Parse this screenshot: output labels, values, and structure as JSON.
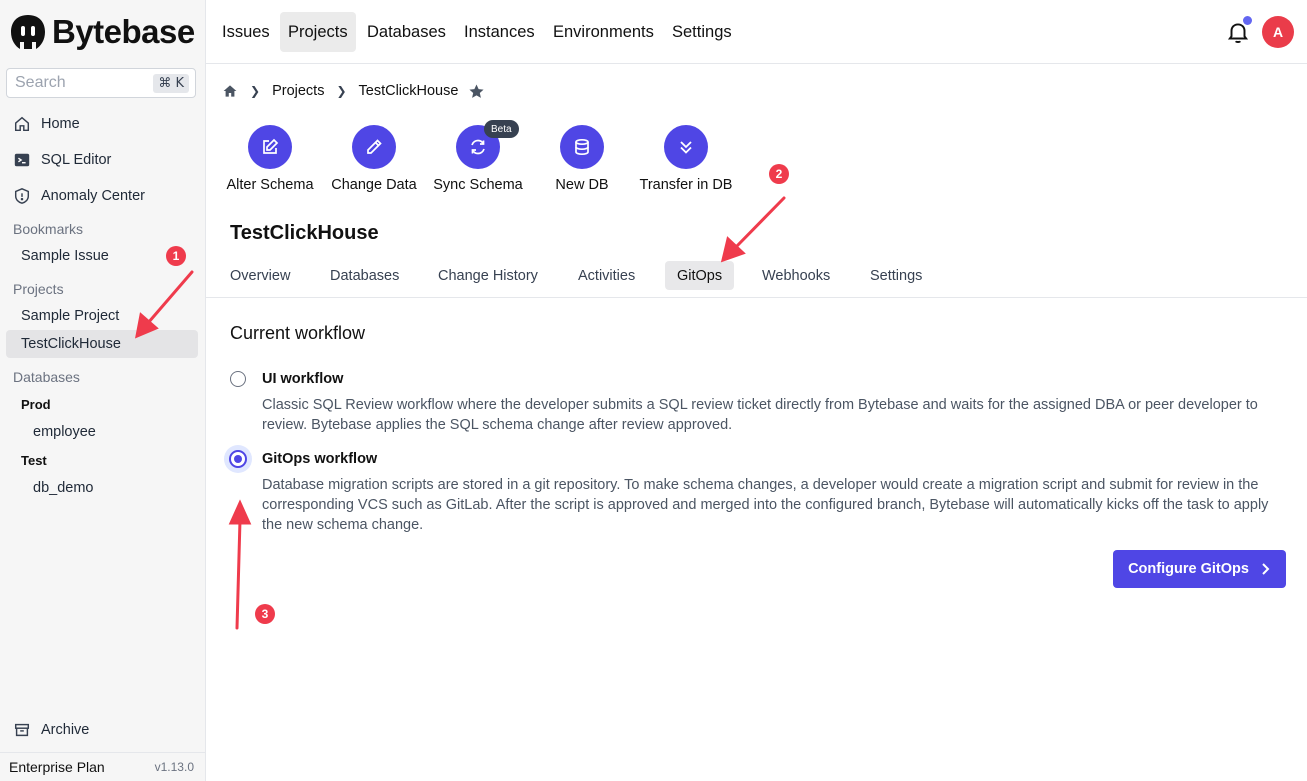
{
  "brand": {
    "name": "Bytebase"
  },
  "search": {
    "placeholder": "Search",
    "shortcut": "⌘ K"
  },
  "sidebar": {
    "nav": [
      {
        "label": "Home",
        "icon": "home-icon"
      },
      {
        "label": "SQL Editor",
        "icon": "terminal-icon"
      },
      {
        "label": "Anomaly Center",
        "icon": "shield-icon"
      }
    ],
    "bookmarks_label": "Bookmarks",
    "bookmarks": [
      {
        "label": "Sample Issue"
      }
    ],
    "projects_label": "Projects",
    "projects": [
      {
        "label": "Sample Project"
      },
      {
        "label": "TestClickHouse",
        "active": true
      }
    ],
    "databases_label": "Databases",
    "environments": [
      {
        "name": "Prod",
        "databases": [
          "employee"
        ]
      },
      {
        "name": "Test",
        "databases": [
          "db_demo"
        ]
      }
    ],
    "archive_label": "Archive",
    "plan": "Enterprise Plan",
    "version": "v1.13.0"
  },
  "topnav": {
    "items": [
      "Issues",
      "Projects",
      "Databases",
      "Instances",
      "Environments",
      "Settings"
    ],
    "active": "Projects",
    "avatar_initial": "A"
  },
  "breadcrumb": {
    "section": "Projects",
    "current": "TestClickHouse"
  },
  "quick_actions": [
    {
      "label": "Alter Schema",
      "icon": "edit-icon"
    },
    {
      "label": "Change Data",
      "icon": "pencil-icon"
    },
    {
      "label": "Sync Schema",
      "icon": "refresh-icon",
      "badge": "Beta"
    },
    {
      "label": "New DB",
      "icon": "database-icon"
    },
    {
      "label": "Transfer in DB",
      "icon": "chevrons-down-icon"
    }
  ],
  "project": {
    "title": "TestClickHouse"
  },
  "tabs": [
    "Overview",
    "Databases",
    "Change History",
    "Activities",
    "GitOps",
    "Webhooks",
    "Settings"
  ],
  "active_tab": "GitOps",
  "workflow": {
    "title": "Current workflow",
    "options": [
      {
        "title": "UI workflow",
        "desc": "Classic SQL Review workflow where the developer submits a SQL review ticket directly from Bytebase and waits for the assigned DBA or peer developer to review. Bytebase applies the SQL schema change after review approved.",
        "selected": false
      },
      {
        "title": "GitOps workflow",
        "desc": "Database migration scripts are stored in a git repository. To make schema changes, a developer would create a migration script and submit for review in the corresponding VCS such as GitLab. After the script is approved and merged into the configured branch, Bytebase will automatically kicks off the task to apply the new schema change.",
        "selected": true
      }
    ],
    "configure_label": "Configure GitOps"
  },
  "annotations": {
    "step1": "1",
    "step2": "2",
    "step3": "3",
    "color": "#ef3b4c"
  },
  "colors": {
    "accent": "#4f46e5",
    "avatar": "#ea3c4a"
  }
}
